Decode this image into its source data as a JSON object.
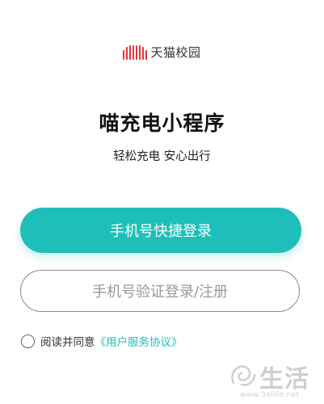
{
  "brand": {
    "name": "天猫校园",
    "accent": "#e8323c"
  },
  "title": "喵充电小程序",
  "subtitle": "轻松充电 安心出行",
  "buttons": {
    "quick_login": "手机号快捷登录",
    "code_login": "手机号验证登录/注册"
  },
  "agreement": {
    "text": "阅读并同意",
    "link": "《用户服务协议》",
    "checked": false
  },
  "watermark": {
    "text": "生活",
    "url": "www.3elife.net"
  },
  "colors": {
    "primary": "#1dbfb8",
    "border": "#8a8a8a",
    "placeholder_text": "#999999"
  }
}
